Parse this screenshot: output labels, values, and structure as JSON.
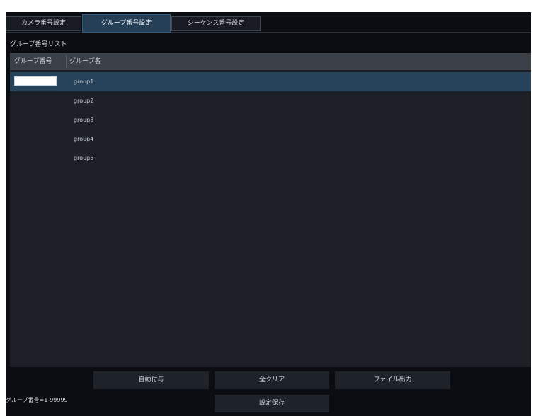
{
  "tabs": [
    {
      "label": "カメラ番号設定",
      "active": false
    },
    {
      "label": "グループ番号設定",
      "active": true
    },
    {
      "label": "シーケンス番号設定",
      "active": false
    }
  ],
  "section_title": "グループ番号リスト",
  "table": {
    "columns": [
      "グループ番号",
      "グループ名"
    ],
    "rows": [
      {
        "number": "",
        "name": "group1",
        "selected": true
      },
      {
        "number": "",
        "name": "group2",
        "selected": false
      },
      {
        "number": "",
        "name": "group3",
        "selected": false
      },
      {
        "number": "",
        "name": "group4",
        "selected": false
      },
      {
        "number": "",
        "name": "group5",
        "selected": false
      }
    ]
  },
  "buttons": {
    "auto_assign": "自動付与",
    "clear_all": "全クリア",
    "file_output": "ファイル出力",
    "save": "設定保存"
  },
  "footer_note": "グループ番号=1-99999",
  "colors": {
    "background": "#0b0d12",
    "active_tab": "#253f57",
    "selected_row": "#27435c",
    "list_background": "#1d2027",
    "header_background": "#3b3f47"
  }
}
